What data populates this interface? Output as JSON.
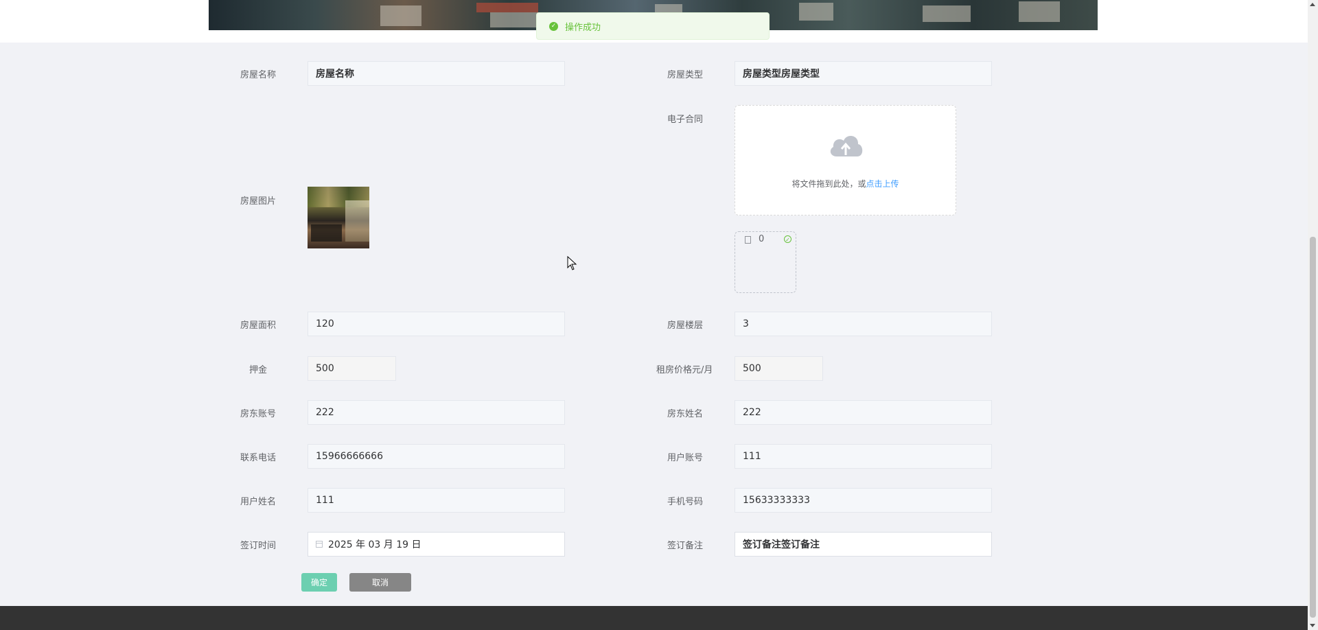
{
  "toast": {
    "message": "操作成功"
  },
  "form": {
    "house_name": {
      "label": "房屋名称",
      "value": "房屋名称"
    },
    "house_type": {
      "label": "房屋类型",
      "value": "房屋类型房屋类型"
    },
    "contract": {
      "label": "电子合同",
      "drag_text": "将文件拖到此处，或",
      "drag_link": "点击上传",
      "file_name": "0"
    },
    "house_image": {
      "label": "房屋图片"
    },
    "house_area": {
      "label": "房屋面积",
      "value": "120"
    },
    "house_floor": {
      "label": "房屋楼层",
      "value": "3"
    },
    "deposit": {
      "label": "押金",
      "value": "500"
    },
    "rent_price": {
      "label": "租房价格元/月",
      "value": "500"
    },
    "landlord_account": {
      "label": "房东账号",
      "value": "222"
    },
    "landlord_name": {
      "label": "房东姓名",
      "value": "222"
    },
    "contact_phone": {
      "label": "联系电话",
      "value": "15966666666"
    },
    "user_account": {
      "label": "用户账号",
      "value": "111"
    },
    "user_name": {
      "label": "用户姓名",
      "value": "111"
    },
    "mobile": {
      "label": "手机号码",
      "value": "15633333333"
    },
    "sign_time": {
      "label": "签订时间",
      "value": "2025 年 03 月 19 日"
    },
    "sign_note": {
      "label": "签订备注",
      "value": "签订备注签订备注"
    }
  },
  "buttons": {
    "confirm": "确定",
    "cancel": "取消"
  },
  "colors": {
    "primary": "#409eff",
    "success": "#67c23a",
    "confirm_button": "#6ccfb0",
    "cancel_button": "#868686",
    "footer": "#333333"
  },
  "icons": [
    "success-icon",
    "upload-cloud-icon",
    "document-icon",
    "check-circle-icon",
    "calendar-icon"
  ]
}
